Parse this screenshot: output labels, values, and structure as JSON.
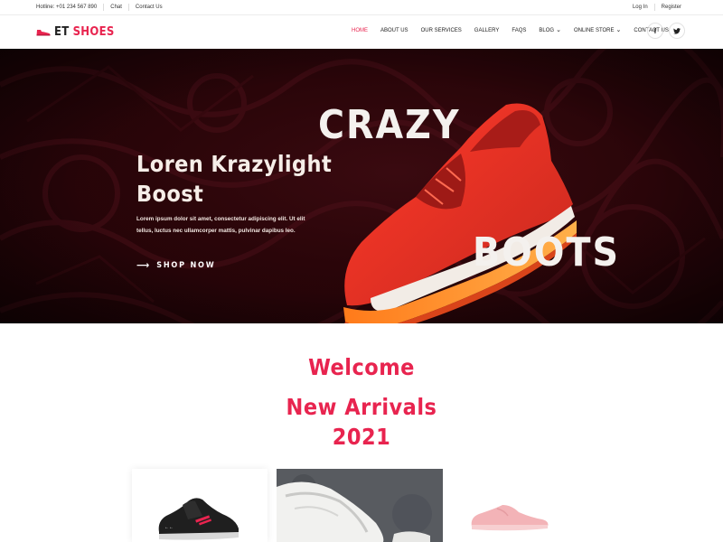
{
  "topbar": {
    "hotline": "Hotline: +01 234 567 890",
    "chat": "Chat",
    "contact": "Contact Us",
    "login": "Log In",
    "register": "Register"
  },
  "brand": {
    "prefix": "ET",
    "name": "SHOES",
    "accent_color": "#e8244f"
  },
  "nav": {
    "items": [
      {
        "label": "HOME",
        "active": true
      },
      {
        "label": "ABOUT US"
      },
      {
        "label": "OUR SERVICES"
      },
      {
        "label": "GALLERY"
      },
      {
        "label": "FAQS"
      },
      {
        "label": "BLOG",
        "dropdown": true
      },
      {
        "label": "ONLINE STORE",
        "dropdown": true
      },
      {
        "label": "CONTACT US"
      }
    ]
  },
  "social": {
    "facebook": "f",
    "twitter_icon": "twitter-icon"
  },
  "hero": {
    "title_line1": "Loren Krazylight",
    "title_line2": "Boost",
    "text_line1": "Lorem ipsum dolor sit amet, consectetur adipiscing elit. Ut elit",
    "text_line2": "tellus, luctus nec ullamcorper mattis, pulvinar dapibus leo.",
    "cta": "SHOP NOW",
    "word_top": "CRAZY",
    "word_bottom": "BOOTS"
  },
  "arrivals": {
    "welcome": "Welcome",
    "line1": "New Arrivals",
    "line2": "2021"
  }
}
